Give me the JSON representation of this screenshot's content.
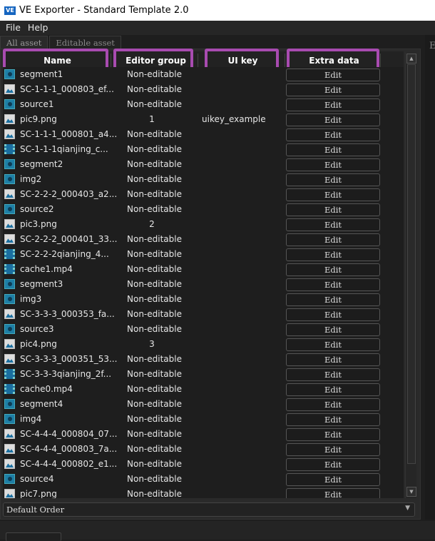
{
  "window": {
    "title": "VE Exporter - Standard Template 2.0",
    "logo": "VE"
  },
  "menu": [
    "File",
    "Help"
  ],
  "tabs": [
    "All asset",
    "Editable asset"
  ],
  "columns": [
    "Name",
    "Editor group",
    "UI key",
    "Extra data"
  ],
  "rows": [
    {
      "icon": "seg",
      "name": "segment1",
      "group": "Non-editable",
      "uikey": ""
    },
    {
      "icon": "pic",
      "name": "SC-1-1-1_000803_ef...",
      "group": "Non-editable",
      "uikey": ""
    },
    {
      "icon": "seg",
      "name": "source1",
      "group": "Non-editable",
      "uikey": ""
    },
    {
      "icon": "pic",
      "name": "pic9.png",
      "group": "1",
      "uikey": "uikey_example"
    },
    {
      "icon": "pic",
      "name": "SC-1-1-1_000801_a4...",
      "group": "Non-editable",
      "uikey": ""
    },
    {
      "icon": "vid",
      "name": "SC-1-1-1qianjing_c...",
      "group": "Non-editable",
      "uikey": ""
    },
    {
      "icon": "seg",
      "name": "segment2",
      "group": "Non-editable",
      "uikey": ""
    },
    {
      "icon": "seg",
      "name": "img2",
      "group": "Non-editable",
      "uikey": ""
    },
    {
      "icon": "pic",
      "name": "SC-2-2-2_000403_a2...",
      "group": "Non-editable",
      "uikey": ""
    },
    {
      "icon": "seg",
      "name": "source2",
      "group": "Non-editable",
      "uikey": ""
    },
    {
      "icon": "pic",
      "name": "pic3.png",
      "group": "2",
      "uikey": ""
    },
    {
      "icon": "pic",
      "name": "SC-2-2-2_000401_33...",
      "group": "Non-editable",
      "uikey": ""
    },
    {
      "icon": "vid",
      "name": "SC-2-2-2qianjing_4...",
      "group": "Non-editable",
      "uikey": ""
    },
    {
      "icon": "vid",
      "name": "cache1.mp4",
      "group": "Non-editable",
      "uikey": ""
    },
    {
      "icon": "seg",
      "name": "segment3",
      "group": "Non-editable",
      "uikey": ""
    },
    {
      "icon": "seg",
      "name": "img3",
      "group": "Non-editable",
      "uikey": ""
    },
    {
      "icon": "pic",
      "name": "SC-3-3-3_000353_fa...",
      "group": "Non-editable",
      "uikey": ""
    },
    {
      "icon": "seg",
      "name": "source3",
      "group": "Non-editable",
      "uikey": ""
    },
    {
      "icon": "pic",
      "name": "pic4.png",
      "group": "3",
      "uikey": ""
    },
    {
      "icon": "pic",
      "name": "SC-3-3-3_000351_53...",
      "group": "Non-editable",
      "uikey": ""
    },
    {
      "icon": "vid",
      "name": "SC-3-3-3qianjing_2f...",
      "group": "Non-editable",
      "uikey": ""
    },
    {
      "icon": "vid",
      "name": "cache0.mp4",
      "group": "Non-editable",
      "uikey": ""
    },
    {
      "icon": "seg",
      "name": "segment4",
      "group": "Non-editable",
      "uikey": ""
    },
    {
      "icon": "seg",
      "name": "img4",
      "group": "Non-editable",
      "uikey": ""
    },
    {
      "icon": "pic",
      "name": "SC-4-4-4_000804_07...",
      "group": "Non-editable",
      "uikey": ""
    },
    {
      "icon": "pic",
      "name": "SC-4-4-4_000803_7a...",
      "group": "Non-editable",
      "uikey": ""
    },
    {
      "icon": "pic",
      "name": "SC-4-4-4_000802_e1...",
      "group": "Non-editable",
      "uikey": ""
    },
    {
      "icon": "seg",
      "name": "source4",
      "group": "Non-editable",
      "uikey": ""
    },
    {
      "icon": "pic",
      "name": "pic7.png",
      "group": "Non-editable",
      "uikey": ""
    }
  ],
  "edit_label": "Edit",
  "order_select": "Default Order",
  "right_panel_letter": "E",
  "highlight_color": "#a84bb0"
}
